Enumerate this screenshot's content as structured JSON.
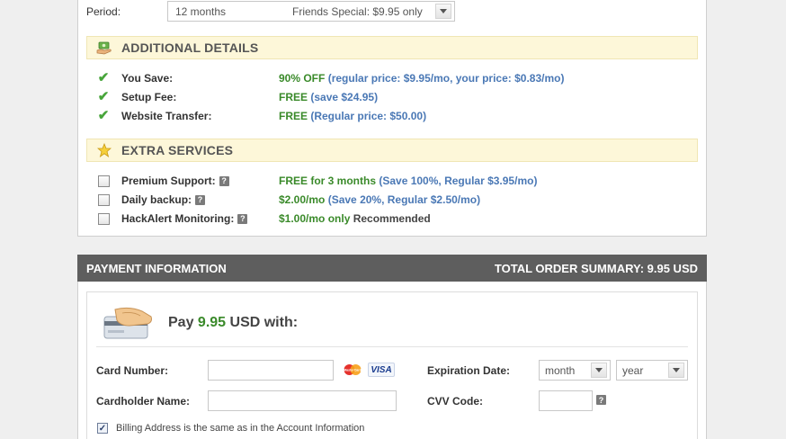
{
  "period": {
    "label": "Period:",
    "selected_term": "12 months",
    "selected_offer": "Friends Special: $9.95 only"
  },
  "additional_details": {
    "title": "ADDITIONAL DETAILS",
    "items": [
      {
        "label": "You Save:",
        "value_green": "90% OFF",
        "value_blue": " (regular price: $9.95/mo, your price: $0.83/mo)"
      },
      {
        "label": "Setup Fee:",
        "value_green": "FREE",
        "value_blue": " (save $24.95)"
      },
      {
        "label": "Website Transfer:",
        "value_green": "FREE",
        "value_blue": " (Regular price: $50.00)"
      }
    ]
  },
  "extra_services": {
    "title": "EXTRA SERVICES",
    "help_glyph": "?",
    "items": [
      {
        "label": "Premium Support:",
        "value_green": "FREE for 3 months",
        "value_blue": " (Save 100%, Regular $3.95/mo)",
        "value_dark": "",
        "checked": false
      },
      {
        "label": "Daily backup:",
        "value_green": "$2.00/mo",
        "value_blue": " (Save 20%, Regular $2.50/mo)",
        "value_dark": "",
        "checked": false
      },
      {
        "label": "HackAlert Monitoring:",
        "value_green": "$1.00/mo only",
        "value_blue": "",
        "value_dark": " Recommended",
        "checked": false
      }
    ]
  },
  "payment": {
    "header_left": "PAYMENT INFORMATION",
    "header_right": "TOTAL ORDER SUMMARY: 9.95 USD",
    "pay_prefix": "Pay ",
    "pay_amount": "9.95",
    "pay_suffix": " USD with:",
    "card_number_label": "Card Number:",
    "cardholder_label": "Cardholder Name:",
    "expiration_label": "Expiration Date:",
    "cvv_label": "CVV Code:",
    "month_value": "month",
    "year_value": "year",
    "card_number_value": "",
    "cardholder_value": "",
    "cvv_value": "",
    "visa_text": "VISA",
    "mastercard_text": "MasterCard",
    "billing_same_label": "Billing Address is the same as in the Account Information",
    "billing_same_checked": true
  },
  "colors": {
    "green": "#3a8a2a",
    "blue": "#4a78b5",
    "header_bg": "#5e5e5e",
    "section_bg": "#fdf7d9"
  }
}
